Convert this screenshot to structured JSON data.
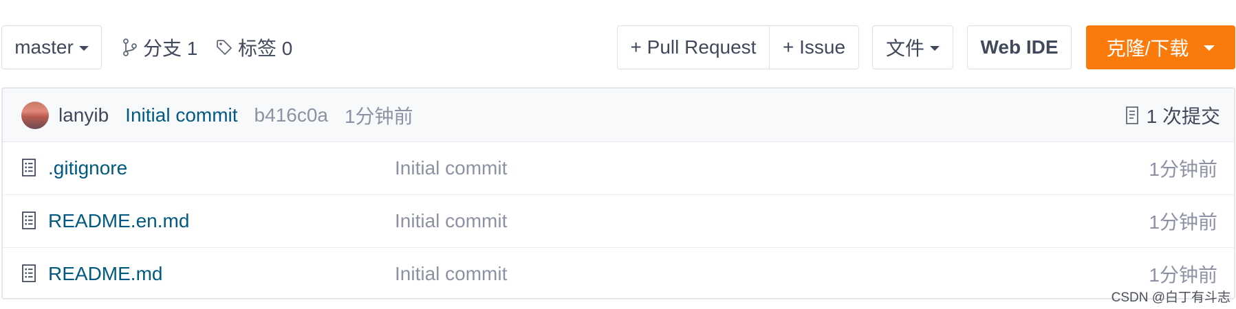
{
  "toolbar": {
    "branch_selector": "master",
    "branches_label": "分支 1",
    "tags_label": "标签 0",
    "pull_request_label": "+ Pull Request",
    "issue_label": "+ Issue",
    "files_label": "文件",
    "web_ide_label": "Web IDE",
    "clone_label": "克隆/下载",
    "accent_color": "#fa7b0b"
  },
  "last_commit": {
    "author": "lanyib",
    "message": "Initial commit",
    "sha": "b416c0a",
    "time": "1分钟前",
    "commits_count_label": "1 次提交"
  },
  "files": [
    {
      "name": ".gitignore",
      "commit": "Initial commit",
      "time": "1分钟前",
      "icon": "file-text-icon"
    },
    {
      "name": "README.en.md",
      "commit": "Initial commit",
      "time": "1分钟前",
      "icon": "file-text-icon"
    },
    {
      "name": "README.md",
      "commit": "Initial commit",
      "time": "1分钟前",
      "icon": "file-text-icon"
    }
  ],
  "watermark": "CSDN @白丁有斗志"
}
